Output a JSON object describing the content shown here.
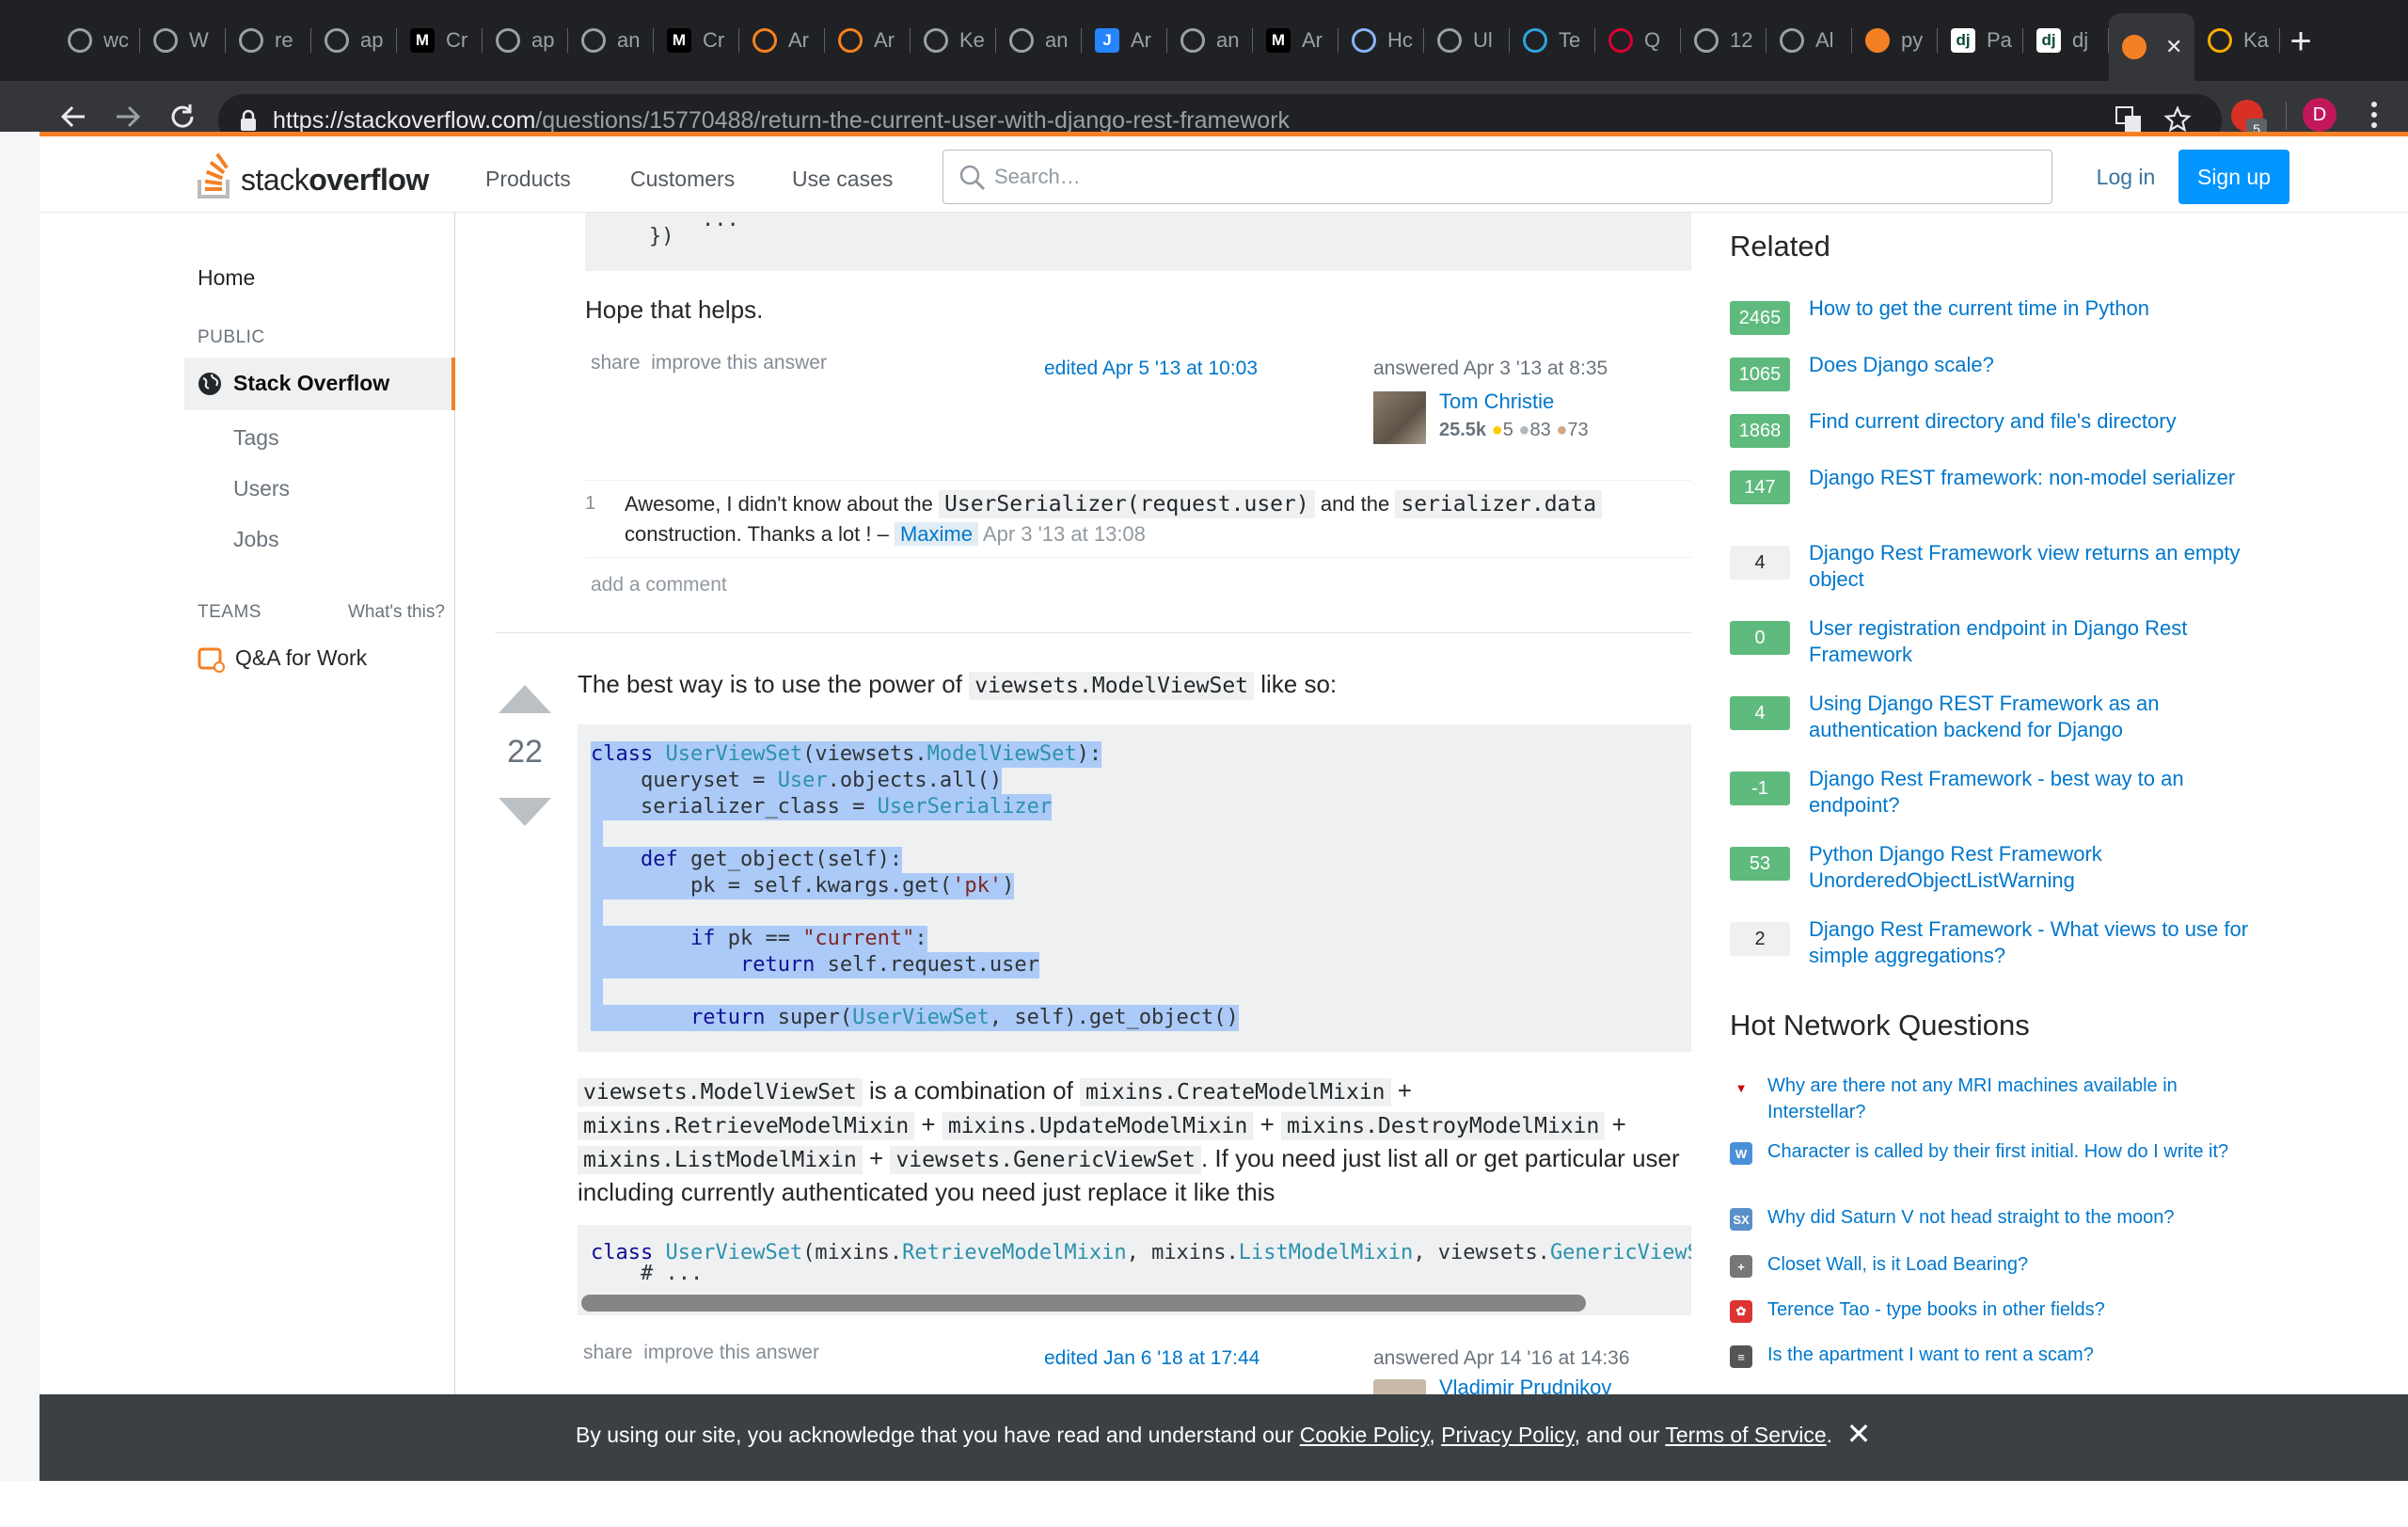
{
  "browser": {
    "tabs": [
      {
        "label": "wc",
        "icon": "github-icon"
      },
      {
        "label": "W",
        "icon": "github-icon"
      },
      {
        "label": "re",
        "icon": "github-icon"
      },
      {
        "label": "ap",
        "icon": "github-icon"
      },
      {
        "label": "Cr",
        "icon": "medium-icon"
      },
      {
        "label": "ap",
        "icon": "github-icon"
      },
      {
        "label": "an",
        "icon": "github-icon"
      },
      {
        "label": "Cr",
        "icon": "medium-icon"
      },
      {
        "label": "Ar",
        "icon": "cloudflare-icon"
      },
      {
        "label": "Ar",
        "icon": "cloudflare-icon"
      },
      {
        "label": "Ke",
        "icon": "globe-icon"
      },
      {
        "label": "an",
        "icon": "github-icon"
      },
      {
        "label": "Ar",
        "icon": "jira-icon"
      },
      {
        "label": "an",
        "icon": "github-icon"
      },
      {
        "label": "Ar",
        "icon": "medium-icon"
      },
      {
        "label": "Hc",
        "icon": "eye-icon"
      },
      {
        "label": "Ul",
        "icon": "github-icon"
      },
      {
        "label": "Te",
        "icon": "telegram-icon"
      },
      {
        "label": "Q",
        "icon": "angular-icon"
      },
      {
        "label": "12",
        "icon": "globe-icon"
      },
      {
        "label": "Al",
        "icon": "github-icon"
      },
      {
        "label": "py",
        "icon": "stackoverflow-icon"
      },
      {
        "label": "Pa",
        "icon": "django-icon"
      },
      {
        "label": "dj",
        "icon": "django-icon"
      },
      {
        "label": "",
        "icon": "stackoverflow-icon",
        "active": true
      },
      {
        "label": "Ka",
        "icon": "glasses-icon"
      }
    ],
    "url_host": "https://stackoverflow.com",
    "url_path": "/questions/15770488/return-the-current-user-with-django-rest-framework",
    "new_tab": "+",
    "ext_badge": "5",
    "profile_initial": "D",
    "django_glyph": "dj",
    "medium_glyph": "M",
    "jira_glyph": "J"
  },
  "header": {
    "logo_light": "stack",
    "logo_bold": "overflow",
    "nav": [
      "Products",
      "Customers",
      "Use cases"
    ],
    "search_placeholder": "Search…",
    "login": "Log in",
    "signup": "Sign up"
  },
  "leftnav": {
    "home": "Home",
    "public_heading": "PUBLIC",
    "stackoverflow": "Stack Overflow",
    "tags": "Tags",
    "users": "Users",
    "jobs": "Jobs",
    "teams_heading": "TEAMS",
    "whats_this": "What's this?",
    "qa_for_work": "Q&A for Work"
  },
  "answer1": {
    "code_tail_1": "...",
    "code_tail_2": "})",
    "text": "Hope that helps.",
    "share": "share",
    "improve": "improve this answer",
    "edited": "edited Apr 5 '13 at 10:03",
    "answered": "answered Apr 3 '13 at 8:35",
    "user_name": "Tom Christie",
    "user_rep": "25.5k",
    "gold": "5",
    "silver": "83",
    "bronze": "73",
    "comment": {
      "votes": "1",
      "text_1": "Awesome, I didn't know about the ",
      "code_1": "UserSerializer(request.user)",
      "text_2": " and the ",
      "code_2": "serializer.data",
      "text_3": "construction. Thanks a lot ! –",
      "user": "Maxime",
      "date": "Apr 3 '13 at 13:08"
    },
    "add_comment": "add a comment"
  },
  "answer2": {
    "votes": "22",
    "intro_1": "The best way is to use the power of ",
    "intro_code": "viewsets.ModelViewSet",
    "intro_2": " like so:",
    "code_lines": [
      [
        [
          "kw",
          "class"
        ],
        [
          "p",
          " "
        ],
        [
          "ty",
          "UserViewSet"
        ],
        [
          "p",
          "(viewsets."
        ],
        [
          "ty",
          "ModelViewSet"
        ],
        [
          "p",
          "):"
        ]
      ],
      [
        [
          "p",
          "    queryset = "
        ],
        [
          "ty",
          "User"
        ],
        [
          "p",
          ".objects.all()"
        ]
      ],
      [
        [
          "p",
          "    serializer_class = "
        ],
        [
          "ty",
          "UserSerializer"
        ]
      ],
      [
        [
          "p",
          " "
        ]
      ],
      [
        [
          "p",
          "    "
        ],
        [
          "kw",
          "def"
        ],
        [
          "p",
          " get_object(self):"
        ]
      ],
      [
        [
          "p",
          "        pk = self.kwargs.get("
        ],
        [
          "st",
          "'pk'"
        ],
        [
          "p",
          ")"
        ]
      ],
      [
        [
          "p",
          " "
        ]
      ],
      [
        [
          "p",
          "        "
        ],
        [
          "kw",
          "if"
        ],
        [
          "p",
          " pk == "
        ],
        [
          "st",
          "\"current\""
        ],
        [
          "p",
          ":"
        ]
      ],
      [
        [
          "p",
          "            "
        ],
        [
          "kw",
          "return"
        ],
        [
          "p",
          " self.request.user"
        ]
      ],
      [
        [
          "p",
          " "
        ]
      ],
      [
        [
          "p",
          "        "
        ],
        [
          "kw",
          "return"
        ],
        [
          "p",
          " super("
        ],
        [
          "ty",
          "UserViewSet"
        ],
        [
          "p",
          ", self).get_object()"
        ]
      ]
    ],
    "p2_code_1": "viewsets.ModelViewSet",
    "p2_text_1": " is a combination of ",
    "p2_code_2": "mixins.CreateModelMixin",
    "plus": "+",
    "p2_code_3": "mixins.RetrieveModelMixin",
    "p2_code_4": "mixins.UpdateModelMixin",
    "p2_code_5": "mixins.DestroyModelMixin",
    "p2_code_6": "mixins.ListModelMixin",
    "p2_code_7": "viewsets.GenericViewSet",
    "p2_text_2": ". If you need just list all or get particular user",
    "p2_text_3": "including currently authenticated you need just replace it like this",
    "code2_lines": [
      [
        [
          "kw",
          "class"
        ],
        [
          "p",
          " "
        ],
        [
          "ty",
          "UserViewSet"
        ],
        [
          "p",
          "(mixins."
        ],
        [
          "ty",
          "RetrieveModelMixin"
        ],
        [
          "p",
          ", mixins."
        ],
        [
          "ty",
          "ListModelMixin"
        ],
        [
          "p",
          ", viewsets."
        ],
        [
          "ty",
          "GenericViewSet"
        ],
        [
          "p",
          "):"
        ]
      ],
      [
        [
          "p",
          "    # ..."
        ]
      ]
    ],
    "share": "share",
    "improve": "improve this answer",
    "edited": "edited Jan 6 '18 at 17:44",
    "answered": "answered Apr 14 '16 at 14:36",
    "user_name": "Vladimir Prudnikov"
  },
  "sidebar": {
    "related_heading": "Related",
    "related": [
      {
        "score": "2465",
        "title": "How to get the current time in Python",
        "tone": "pos"
      },
      {
        "score": "1065",
        "title": "Does Django scale?",
        "tone": "pos"
      },
      {
        "score": "1868",
        "title": "Find current directory and file's directory",
        "tone": "pos"
      },
      {
        "score": "147",
        "title": "Django REST framework: non-model serializer",
        "tone": "pos"
      },
      {
        "score": "4",
        "title": "Django Rest Framework view returns an empty object",
        "tone": "zero"
      },
      {
        "score": "0",
        "title": "User registration endpoint in Django Rest Framework",
        "tone": "pos"
      },
      {
        "score": "4",
        "title": "Using Django REST Framework as an authentication backend for Django",
        "tone": "pos"
      },
      {
        "score": "-1",
        "title": "Django Rest Framework - best way to an endpoint?",
        "tone": "pos"
      },
      {
        "score": "53",
        "title": "Python Django Rest Framework UnorderedObjectListWarning",
        "tone": "pos"
      },
      {
        "score": "2",
        "title": "Django Rest Framework - What views to use for simple aggregations?",
        "tone": "zero"
      }
    ],
    "hnq_heading": "Hot Network Questions",
    "hnq": [
      {
        "title": "Why are there not any MRI machines available in Interstellar?",
        "icon": "scifi-icon",
        "color": "#fff",
        "fg": "#c00",
        "glyph": "▼"
      },
      {
        "title": "Character is called by their first initial. How do I write it?",
        "icon": "writing-icon",
        "color": "#4a90d9",
        "fg": "#fff",
        "glyph": "W"
      },
      {
        "title": "Why did Saturn V not head straight to the moon?",
        "icon": "space-icon",
        "color": "#5b8fc7",
        "fg": "#fff",
        "glyph": "SX"
      },
      {
        "title": "Closet Wall, is it Load Bearing?",
        "icon": "diy-icon",
        "color": "#777",
        "fg": "#fff",
        "glyph": "+"
      },
      {
        "title": "Terence Tao - type books in other fields?",
        "icon": "math-icon",
        "color": "#d33",
        "fg": "#fff",
        "glyph": "✿"
      },
      {
        "title": "Is the apartment I want to rent a scam?",
        "icon": "travel-icon",
        "color": "#555",
        "fg": "#fff",
        "glyph": "≡"
      }
    ]
  },
  "cookie": {
    "text_1": "By using our site, you acknowledge that you have read and understand our ",
    "cookie_policy": "Cookie Policy",
    "comma": ", ",
    "privacy_policy": "Privacy Policy",
    "and_our": ", and our ",
    "terms": "Terms of Service",
    "period": ".",
    "close": "✕"
  },
  "colors": {
    "accent": "#f48024",
    "link": "#0077cc",
    "selection": "#abcaf7",
    "score_green": "#5fba7d"
  }
}
